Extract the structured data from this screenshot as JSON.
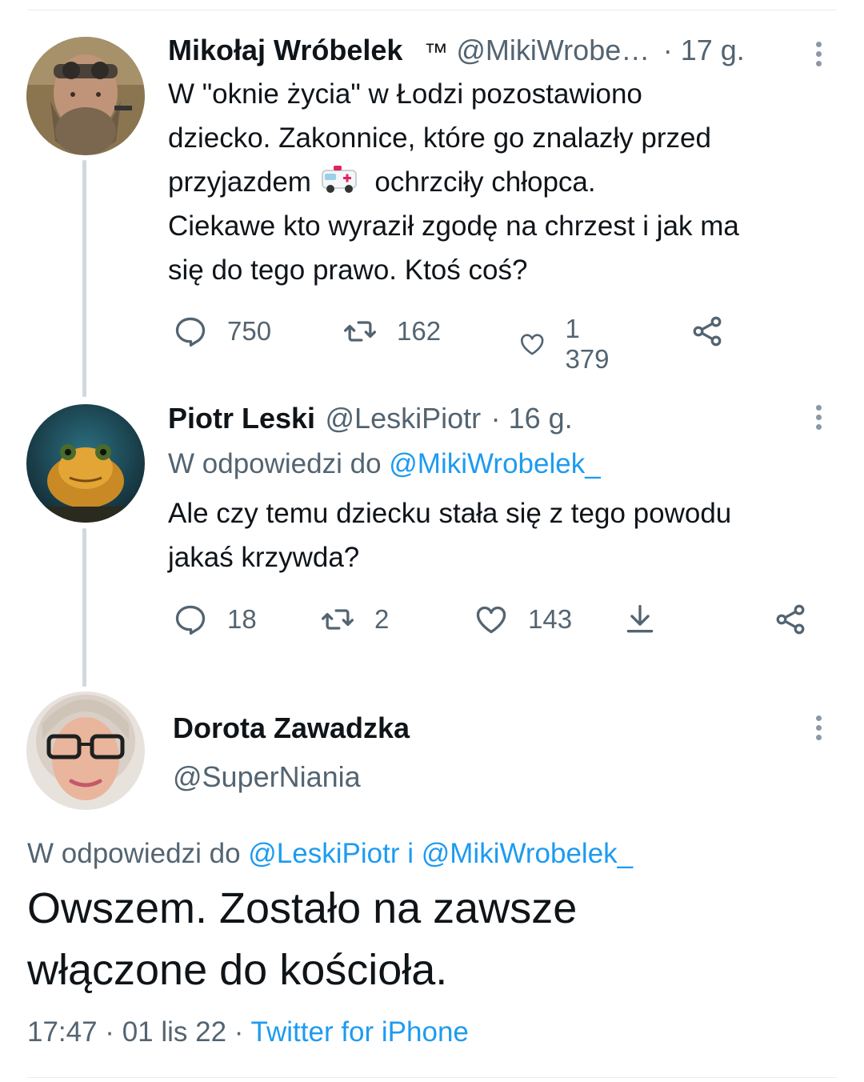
{
  "tweets": [
    {
      "name": "Mikołaj Wróbelek",
      "badge": "™",
      "handle": "@MikiWrobe…",
      "time": "· 17 g.",
      "lines": [
        "W \"oknie życia\" w Łodzi pozostawiono",
        "dziecko. Zakonnice, które go znalazły przed",
        [
          "przyjazdem ",
          " ochrzciły chłopca."
        ],
        "Ciekawe kto wyraził zgodę na chrzest i jak ma",
        "się do tego prawo. Ktoś coś?"
      ],
      "replies": "750",
      "retweets": "162",
      "likes": "1 379"
    },
    {
      "name": "Piotr Leski",
      "handle": "@LeskiPiotr",
      "time": "· 16 g.",
      "reply_prefix": "W odpowiedzi do",
      "reply_to": "@MikiWrobelek_",
      "lines": [
        "Ale czy temu dziecku stała się z tego powodu",
        "jakaś krzywda?"
      ],
      "replies": "18",
      "retweets": "2",
      "likes": "143"
    }
  ],
  "main_tweet": {
    "name": "Dorota Zawadzka",
    "handle": "@SuperNiania",
    "reply_prefix": "W odpowiedzi do",
    "reply_to_1": "@LeskiPiotr",
    "reply_joiner": "i",
    "reply_to_2": "@MikiWrobelek_",
    "lines": [
      "Owszem. Zostało na zawsze",
      "włączone do kościoła."
    ],
    "timestamp": "17:47 · 01 lis 22 ·",
    "source": "Twitter for iPhone"
  },
  "icons": {
    "reply": "reply-icon",
    "retweet": "retweet-icon",
    "like": "heart-icon",
    "share": "share-icon",
    "download": "download-icon",
    "more": "more-icon",
    "ambulance": "ambulance-emoji"
  },
  "colors": {
    "link": "#1d9bf0",
    "secondary": "#536471",
    "text": "#0f1419"
  }
}
